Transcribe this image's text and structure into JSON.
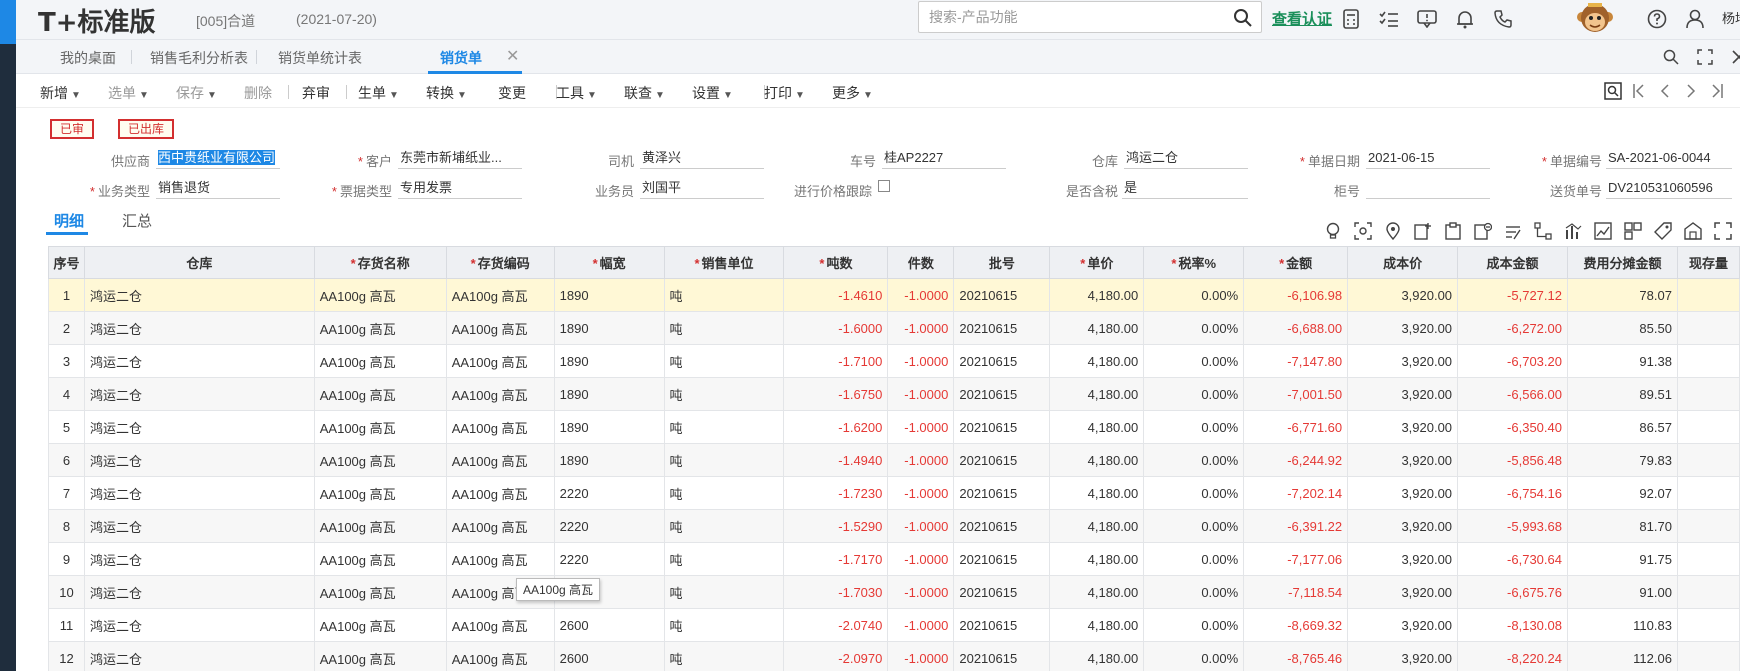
{
  "app": {
    "logo": "T+标准版",
    "company": "[005]合道",
    "date": "(2021-07-20)",
    "search_placeholder": "搜索-产品功能",
    "cert_link": "查看认证",
    "user": "杨培客"
  },
  "tabs": [
    {
      "label": "我的桌面"
    },
    {
      "label": "销售毛利分析表"
    },
    {
      "label": "销货单统计表"
    },
    {
      "label": "销货单",
      "active": true
    }
  ],
  "toolbar": {
    "new": "新增",
    "select": "选单",
    "save": "保存",
    "delete": "删除",
    "unaudit": "弃审",
    "generate": "生单",
    "convert": "转换",
    "change": "变更",
    "tools": "工具",
    "query": "联查",
    "settings": "设置",
    "print": "打印",
    "more": "更多"
  },
  "stamps": {
    "audited": "已审",
    "outbound": "已出库"
  },
  "form": {
    "supplier": {
      "label": "供应商",
      "value": "西中贵纸业有限公司"
    },
    "customer": {
      "label": "客户",
      "value": "东莞市新埔纸业..."
    },
    "driver": {
      "label": "司机",
      "value": "黄泽兴"
    },
    "plate": {
      "label": "车号",
      "value": "桂AP2227"
    },
    "warehouse": {
      "label": "仓库",
      "value": "鸿运二仓"
    },
    "doc_date": {
      "label": "单据日期",
      "value": "2021-06-15"
    },
    "doc_no": {
      "label": "单据编号",
      "value": "SA-2021-06-0044"
    },
    "biz_type": {
      "label": "业务类型",
      "value": "销售退货"
    },
    "invoice_type": {
      "label": "票据类型",
      "value": "专用发票"
    },
    "salesperson": {
      "label": "业务员",
      "value": "刘国平"
    },
    "price_track": {
      "label": "进行价格跟踪"
    },
    "tax_included": {
      "label": "是否含税",
      "value": "是"
    },
    "cabinet": {
      "label": "柜号",
      "value": ""
    },
    "delivery_no": {
      "label": "送货单号",
      "value": "DV210531060596"
    }
  },
  "subtabs": [
    "明细",
    "汇总"
  ],
  "grid": {
    "headers": [
      "序号",
      "仓库",
      "存货名称",
      "存货编码",
      "幅宽",
      "销售单位",
      "吨数",
      "件数",
      "批号",
      "单价",
      "税率%",
      "金额",
      "成本价",
      "成本金额",
      "费用分摊金额",
      "现存量"
    ],
    "rows": [
      [
        "1",
        "鸿运二仓",
        "AA100g 高瓦",
        "AA100g 高瓦",
        "1890",
        "吨",
        "-1.4610",
        "-1.0000",
        "20210615",
        "4,180.00",
        "0.00%",
        "-6,106.98",
        "3,920.00",
        "-5,727.12",
        "78.07",
        ""
      ],
      [
        "2",
        "鸿运二仓",
        "AA100g 高瓦",
        "AA100g 高瓦",
        "1890",
        "吨",
        "-1.6000",
        "-1.0000",
        "20210615",
        "4,180.00",
        "0.00%",
        "-6,688.00",
        "3,920.00",
        "-6,272.00",
        "85.50",
        ""
      ],
      [
        "3",
        "鸿运二仓",
        "AA100g 高瓦",
        "AA100g 高瓦",
        "1890",
        "吨",
        "-1.7100",
        "-1.0000",
        "20210615",
        "4,180.00",
        "0.00%",
        "-7,147.80",
        "3,920.00",
        "-6,703.20",
        "91.38",
        ""
      ],
      [
        "4",
        "鸿运二仓",
        "AA100g 高瓦",
        "AA100g 高瓦",
        "1890",
        "吨",
        "-1.6750",
        "-1.0000",
        "20210615",
        "4,180.00",
        "0.00%",
        "-7,001.50",
        "3,920.00",
        "-6,566.00",
        "89.51",
        ""
      ],
      [
        "5",
        "鸿运二仓",
        "AA100g 高瓦",
        "AA100g 高瓦",
        "1890",
        "吨",
        "-1.6200",
        "-1.0000",
        "20210615",
        "4,180.00",
        "0.00%",
        "-6,771.60",
        "3,920.00",
        "-6,350.40",
        "86.57",
        ""
      ],
      [
        "6",
        "鸿运二仓",
        "AA100g 高瓦",
        "AA100g 高瓦",
        "1890",
        "吨",
        "-1.4940",
        "-1.0000",
        "20210615",
        "4,180.00",
        "0.00%",
        "-6,244.92",
        "3,920.00",
        "-5,856.48",
        "79.83",
        ""
      ],
      [
        "7",
        "鸿运二仓",
        "AA100g 高瓦",
        "AA100g 高瓦",
        "2220",
        "吨",
        "-1.7230",
        "-1.0000",
        "20210615",
        "4,180.00",
        "0.00%",
        "-7,202.14",
        "3,920.00",
        "-6,754.16",
        "92.07",
        ""
      ],
      [
        "8",
        "鸿运二仓",
        "AA100g 高瓦",
        "AA100g 高瓦",
        "2220",
        "吨",
        "-1.5290",
        "-1.0000",
        "20210615",
        "4,180.00",
        "0.00%",
        "-6,391.22",
        "3,920.00",
        "-5,993.68",
        "81.70",
        ""
      ],
      [
        "9",
        "鸿运二仓",
        "AA100g 高瓦",
        "AA100g 高瓦",
        "2220",
        "吨",
        "-1.7170",
        "-1.0000",
        "20210615",
        "4,180.00",
        "0.00%",
        "-7,177.06",
        "3,920.00",
        "-6,730.64",
        "91.75",
        ""
      ],
      [
        "10",
        "鸿运二仓",
        "AA100g 高瓦",
        "AA100g 高瓦",
        "",
        "吨",
        "-1.7030",
        "-1.0000",
        "20210615",
        "4,180.00",
        "0.00%",
        "-7,118.54",
        "3,920.00",
        "-6,675.76",
        "91.00",
        ""
      ],
      [
        "11",
        "鸿运二仓",
        "AA100g 高瓦",
        "AA100g 高瓦",
        "2600",
        "吨",
        "-2.0740",
        "-1.0000",
        "20210615",
        "4,180.00",
        "0.00%",
        "-8,669.32",
        "3,920.00",
        "-8,130.08",
        "110.83",
        ""
      ],
      [
        "12",
        "鸿运二仓",
        "AA100g 高瓦",
        "AA100g 高瓦",
        "2600",
        "吨",
        "-2.0970",
        "-1.0000",
        "20210615",
        "4,180.00",
        "0.00%",
        "-8,765.46",
        "3,920.00",
        "-8,220.24",
        "112.06",
        ""
      ]
    ]
  },
  "tooltip": "AA100g 高瓦",
  "colors": {
    "accent": "#1e88e5",
    "negative": "#e53935",
    "highlight_row": "#fff8d6",
    "cert": "#1a8f5a"
  }
}
